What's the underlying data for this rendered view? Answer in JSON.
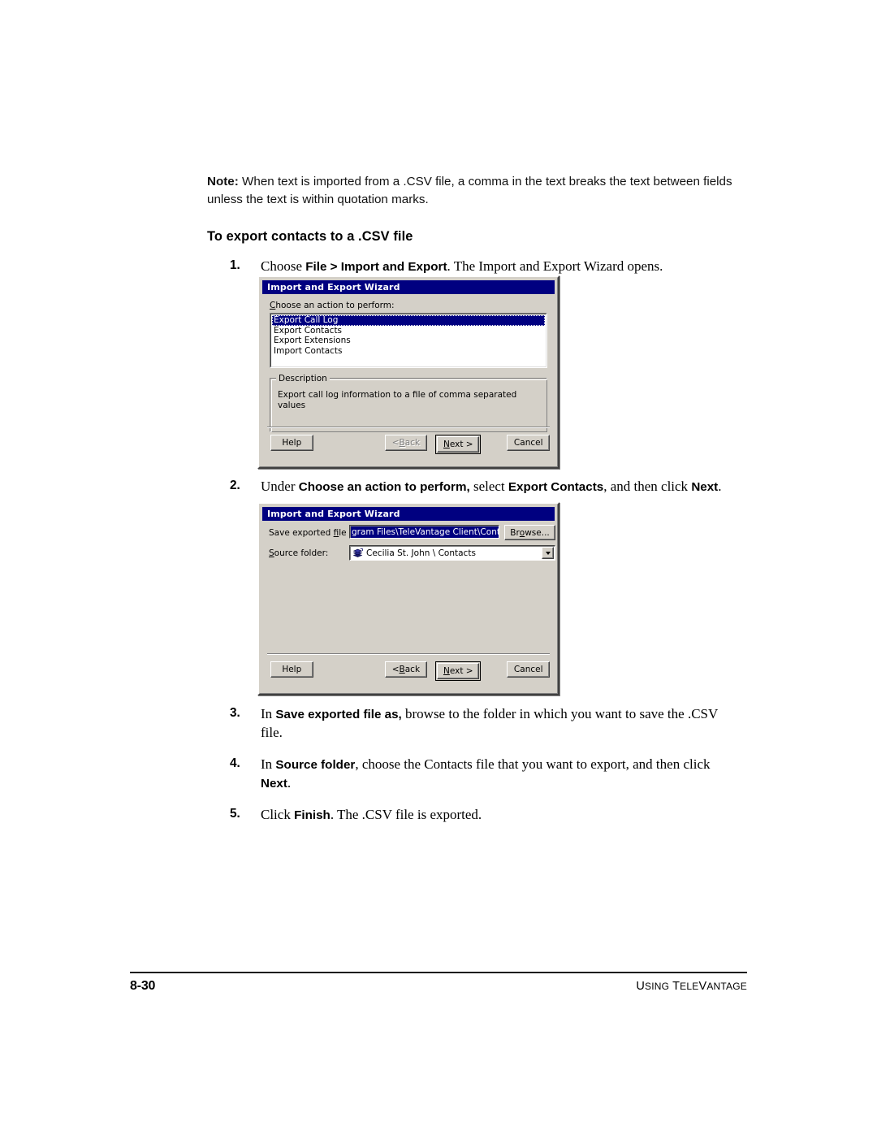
{
  "page": {
    "folio": "8-30",
    "running_head_parts": [
      "U",
      "SING",
      " T",
      "ELE",
      "V",
      "ANTAGE"
    ],
    "running_head": "USING TELEVANTAGE"
  },
  "note": {
    "label": "Note:",
    "text": "When text is imported from a .CSV file, a comma in the text breaks the text between fields unless the text is within quotation marks."
  },
  "heading": "To export contacts to a .CSV file",
  "steps": [
    {
      "num": "1.",
      "parts": [
        {
          "t": "Choose ",
          "b": false
        },
        {
          "t": "File > Import and Export",
          "b": true
        },
        {
          "t": ". The Import and Export Wizard opens.",
          "b": false
        }
      ]
    },
    {
      "num": "2.",
      "parts": [
        {
          "t": "Under ",
          "b": false
        },
        {
          "t": "Choose an action to perform,",
          "b": true
        },
        {
          "t": " select ",
          "b": false
        },
        {
          "t": "Export Contacts",
          "b": true
        },
        {
          "t": ", and then click ",
          "b": false
        },
        {
          "t": "Next",
          "b": true
        },
        {
          "t": ".",
          "b": false
        }
      ]
    },
    {
      "num": "3.",
      "parts": [
        {
          "t": "In ",
          "b": false
        },
        {
          "t": "Save exported file as,",
          "b": true
        },
        {
          "t": " browse to the folder in which you want to save the .CSV file.",
          "b": false
        }
      ]
    },
    {
      "num": "4.",
      "parts": [
        {
          "t": "In ",
          "b": false
        },
        {
          "t": "Source folder",
          "b": true
        },
        {
          "t": ", choose the Contacts file that you want to export, and then click ",
          "b": false
        },
        {
          "t": "Next",
          "b": true
        },
        {
          "t": ".",
          "b": false
        }
      ]
    },
    {
      "num": "5.",
      "parts": [
        {
          "t": "Click ",
          "b": false
        },
        {
          "t": "Finish",
          "b": true
        },
        {
          "t": ". The .CSV file is exported.",
          "b": false
        }
      ]
    }
  ],
  "dialog1": {
    "title": "Import and Export Wizard",
    "list_label_pre": "C",
    "list_label_post": "hoose an action to perform:",
    "items": [
      {
        "label": "Export Call Log",
        "selected": true
      },
      {
        "label": "Export Contacts",
        "selected": false
      },
      {
        "label": "Export Extensions",
        "selected": false
      },
      {
        "label": "Import Contacts",
        "selected": false
      }
    ],
    "description_title": "Description",
    "description_text": "Export call log information to a file of comma separated values",
    "buttons": {
      "help": "Help",
      "back_pre": "< ",
      "back_accel": "B",
      "back_post": "ack",
      "next_pre": "",
      "next_accel": "N",
      "next_post": "ext >",
      "cancel": "Cancel"
    },
    "back_disabled": true
  },
  "dialog2": {
    "title": "Import and Export Wizard",
    "save_label_pre": "Save exported ",
    "save_label_accel": "f",
    "save_label_post": "ile as:",
    "save_value": "gram Files\\TeleVantage Client\\Contacts.csv",
    "browse_pre": "Br",
    "browse_accel": "o",
    "browse_post": "wse...",
    "source_label_accel": "S",
    "source_label_post": "ource folder:",
    "source_value": "Cecilia St. John \\ Contacts",
    "source_icon": "folder-stack-icon",
    "buttons": {
      "help": "Help",
      "back_pre": "< ",
      "back_accel": "B",
      "back_post": "ack",
      "next_accel": "N",
      "next_post": "ext >",
      "cancel": "Cancel"
    },
    "back_disabled": false
  },
  "colors": {
    "titlebar": "#000080",
    "dialog_face": "#d4d0c8",
    "selection": "#000080",
    "selection_text": "#ffffff",
    "disabled_text": "#808080"
  }
}
